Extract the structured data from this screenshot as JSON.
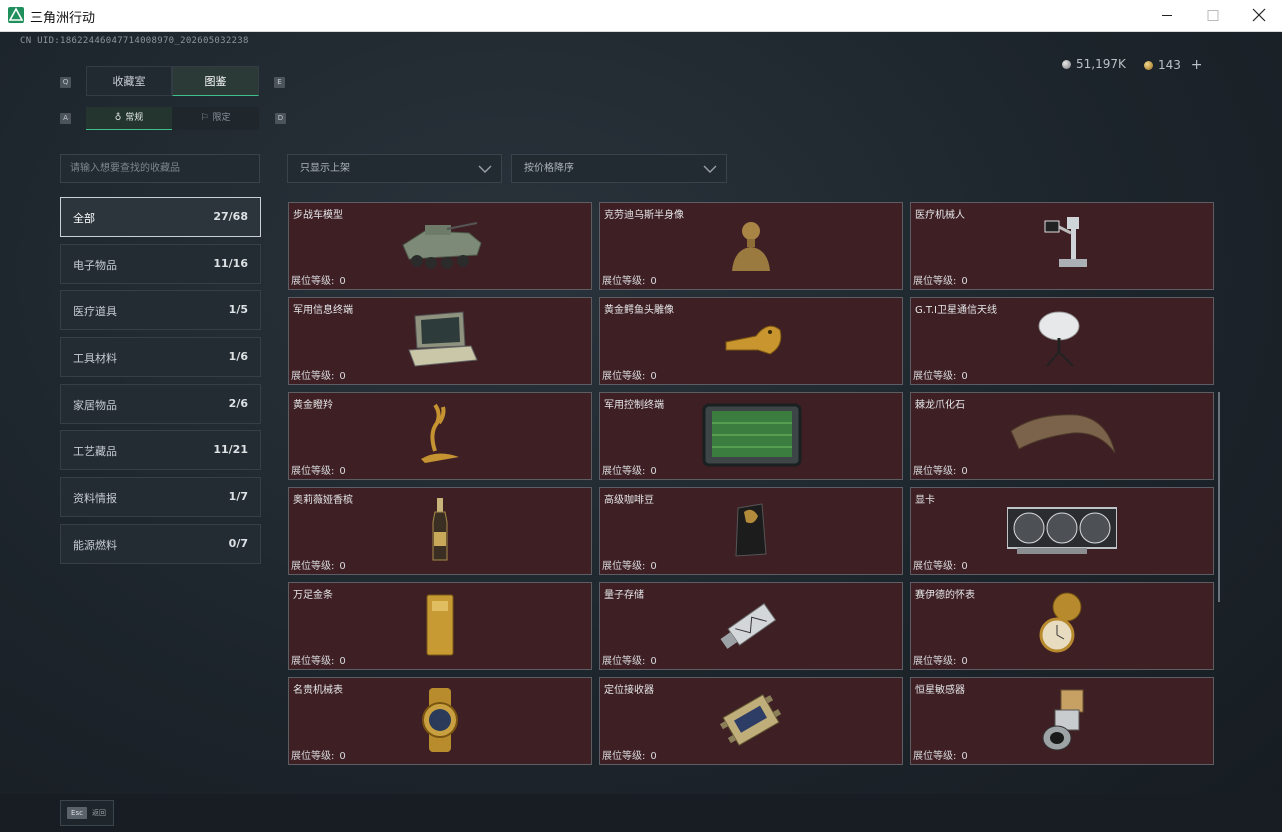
{
  "window": {
    "title": "三角洲行动",
    "min_icon": "minimize-icon",
    "max_icon": "maximize-icon",
    "close_icon": "close-icon"
  },
  "header": {
    "uid": "CN UID:18622446047714008970_202605032238",
    "currency_a": "51,197K",
    "currency_b": "143",
    "plus": "+"
  },
  "tabs": {
    "key_left": "Q",
    "key_right": "E",
    "items": [
      {
        "label": "收藏室"
      },
      {
        "label": "图鉴"
      }
    ]
  },
  "subtabs": {
    "key_left": "A",
    "key_right": "D",
    "items": [
      {
        "label": "常规"
      },
      {
        "label": "限定"
      }
    ]
  },
  "search": {
    "placeholder": "请输入想要查找的收藏品"
  },
  "filters": {
    "listed": "只显示上架",
    "sort": "按价格降序"
  },
  "categories": [
    {
      "label": "全部",
      "count": "27/68"
    },
    {
      "label": "电子物品",
      "count": "11/16"
    },
    {
      "label": "医疗道具",
      "count": "1/5"
    },
    {
      "label": "工具材料",
      "count": "1/6"
    },
    {
      "label": "家居物品",
      "count": "2/6"
    },
    {
      "label": "工艺藏品",
      "count": "11/21"
    },
    {
      "label": "资料情报",
      "count": "1/7"
    },
    {
      "label": "能源燃料",
      "count": "0/7"
    }
  ],
  "level_label": "展位等级:",
  "items": [
    {
      "name": "步战车模型",
      "level": "0",
      "icon": "armored-vehicle-icon"
    },
    {
      "name": "克劳迪乌斯半身像",
      "level": "0",
      "icon": "bust-icon"
    },
    {
      "name": "医疗机械人",
      "level": "0",
      "icon": "medical-robot-icon"
    },
    {
      "name": "军用信息终端",
      "level": "0",
      "icon": "rugged-laptop-icon"
    },
    {
      "name": "黄金鳄鱼头雕像",
      "level": "0",
      "icon": "gold-crocodile-icon"
    },
    {
      "name": "G.T.I卫星通信天线",
      "level": "0",
      "icon": "satellite-dish-icon"
    },
    {
      "name": "黄金瞪羚",
      "level": "0",
      "icon": "gold-gazelle-icon"
    },
    {
      "name": "军用控制终端",
      "level": "0",
      "icon": "control-terminal-icon"
    },
    {
      "name": "棘龙爪化石",
      "level": "0",
      "icon": "claw-fossil-icon"
    },
    {
      "name": "奥莉薇娅香槟",
      "level": "0",
      "icon": "champagne-icon"
    },
    {
      "name": "高级咖啡豆",
      "level": "0",
      "icon": "coffee-bag-icon"
    },
    {
      "name": "显卡",
      "level": "0",
      "icon": "graphics-card-icon"
    },
    {
      "name": "万足金条",
      "level": "0",
      "icon": "gold-bar-icon"
    },
    {
      "name": "量子存储",
      "level": "0",
      "icon": "quantum-drive-icon"
    },
    {
      "name": "赛伊德的怀表",
      "level": "0",
      "icon": "pocket-watch-icon"
    },
    {
      "name": "名贵机械表",
      "level": "0",
      "icon": "wristwatch-icon"
    },
    {
      "name": "定位接收器",
      "level": "0",
      "icon": "gps-receiver-icon"
    },
    {
      "name": "恒星敏感器",
      "level": "0",
      "icon": "star-sensor-icon"
    }
  ],
  "footer": {
    "esc_key": "Esc",
    "esc_label": "返回"
  }
}
